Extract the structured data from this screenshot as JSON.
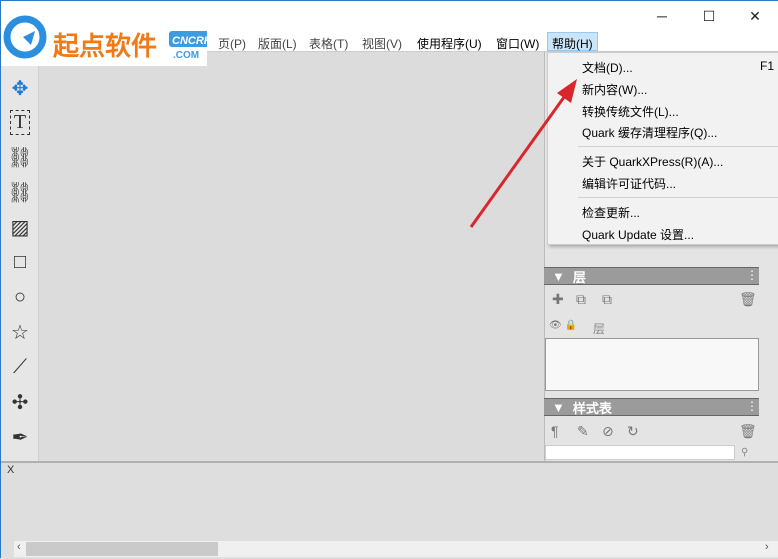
{
  "logo": {
    "text": "起点软件",
    "badge": "CNCRK",
    ".com": ".COM"
  },
  "window_controls": {
    "minimize": "─",
    "maximize": "☐",
    "close": "✕"
  },
  "menubar": {
    "items": [
      "页(P)",
      "版面(L)",
      "表格(T)",
      "视图(V)",
      "使用程序(U)",
      "窗口(W)",
      "帮助(H)"
    ]
  },
  "help_menu": {
    "items": [
      {
        "label": "文档(D)...",
        "shortcut": "F1"
      },
      {
        "label": "新内容(W)..."
      },
      {
        "label": "转换传统文件(L)..."
      },
      {
        "label": "Quark 缓存清理程序(Q)..."
      },
      {
        "label": "关于 QuarkXPress(R)(A)..."
      },
      {
        "label": "编辑许可证代码..."
      },
      {
        "label": "检查更新..."
      },
      {
        "label": "Quark Update 设置..."
      }
    ]
  },
  "layers_panel": {
    "title": "层",
    "column_label": "层"
  },
  "stylesheets_panel": {
    "title": "样式表"
  },
  "bottom_panel": {
    "close": "X"
  },
  "colors": {
    "accent": "#2b79c2",
    "arrow": "#d9262b",
    "menu_active": "#cce4f7"
  }
}
